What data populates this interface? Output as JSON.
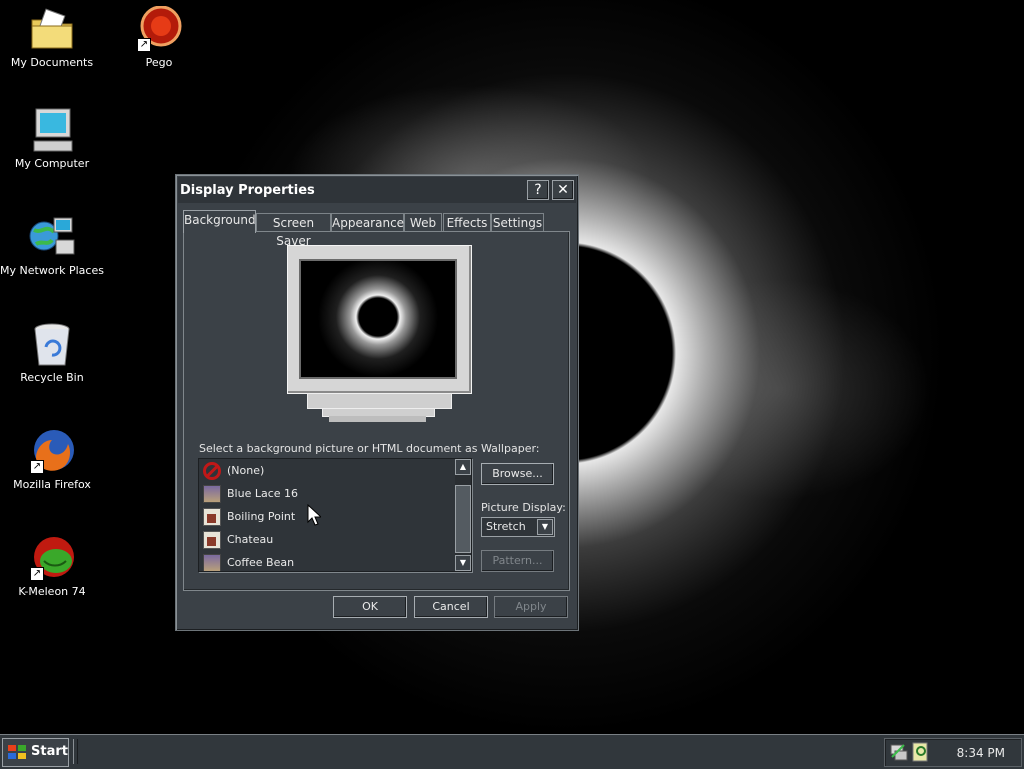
{
  "desktop": {
    "icons": [
      {
        "label": "My Documents",
        "icon": "folder-icon"
      },
      {
        "label": "Pego",
        "icon": "pego-icon"
      },
      {
        "label": "My Computer",
        "icon": "computer-icon"
      },
      {
        "label": "My Network Places",
        "icon": "network-icon"
      },
      {
        "label": "Recycle Bin",
        "icon": "recycle-bin-icon"
      },
      {
        "label": "Mozilla Firefox",
        "icon": "firefox-icon"
      },
      {
        "label": "K-Meleon 74",
        "icon": "kmeleon-icon"
      }
    ]
  },
  "dialog": {
    "title": "Display Properties",
    "help_glyph": "?",
    "close_glyph": "✕",
    "tabs": [
      {
        "label": "Background",
        "active": true
      },
      {
        "label": "Screen Saver"
      },
      {
        "label": "Appearance"
      },
      {
        "label": "Web"
      },
      {
        "label": "Effects"
      },
      {
        "label": "Settings"
      }
    ],
    "prompt": "Select a background picture or HTML document as Wallpaper:",
    "wallpapers": [
      {
        "label": "(None)",
        "icon": "none-icon"
      },
      {
        "label": "Blue Lace 16",
        "icon": "paint-icon"
      },
      {
        "label": "Boiling Point",
        "icon": "picture-icon"
      },
      {
        "label": "Chateau",
        "icon": "picture-icon"
      },
      {
        "label": "Coffee Bean",
        "icon": "paint-icon"
      }
    ],
    "browse_label": "Browse...",
    "picture_display_label": "Picture Display:",
    "picture_display_value": "Stretch",
    "pattern_label": "Pattern...",
    "ok_label": "OK",
    "cancel_label": "Cancel",
    "apply_label": "Apply"
  },
  "taskbar": {
    "start_label": "Start",
    "clock": "8:34 PM"
  }
}
